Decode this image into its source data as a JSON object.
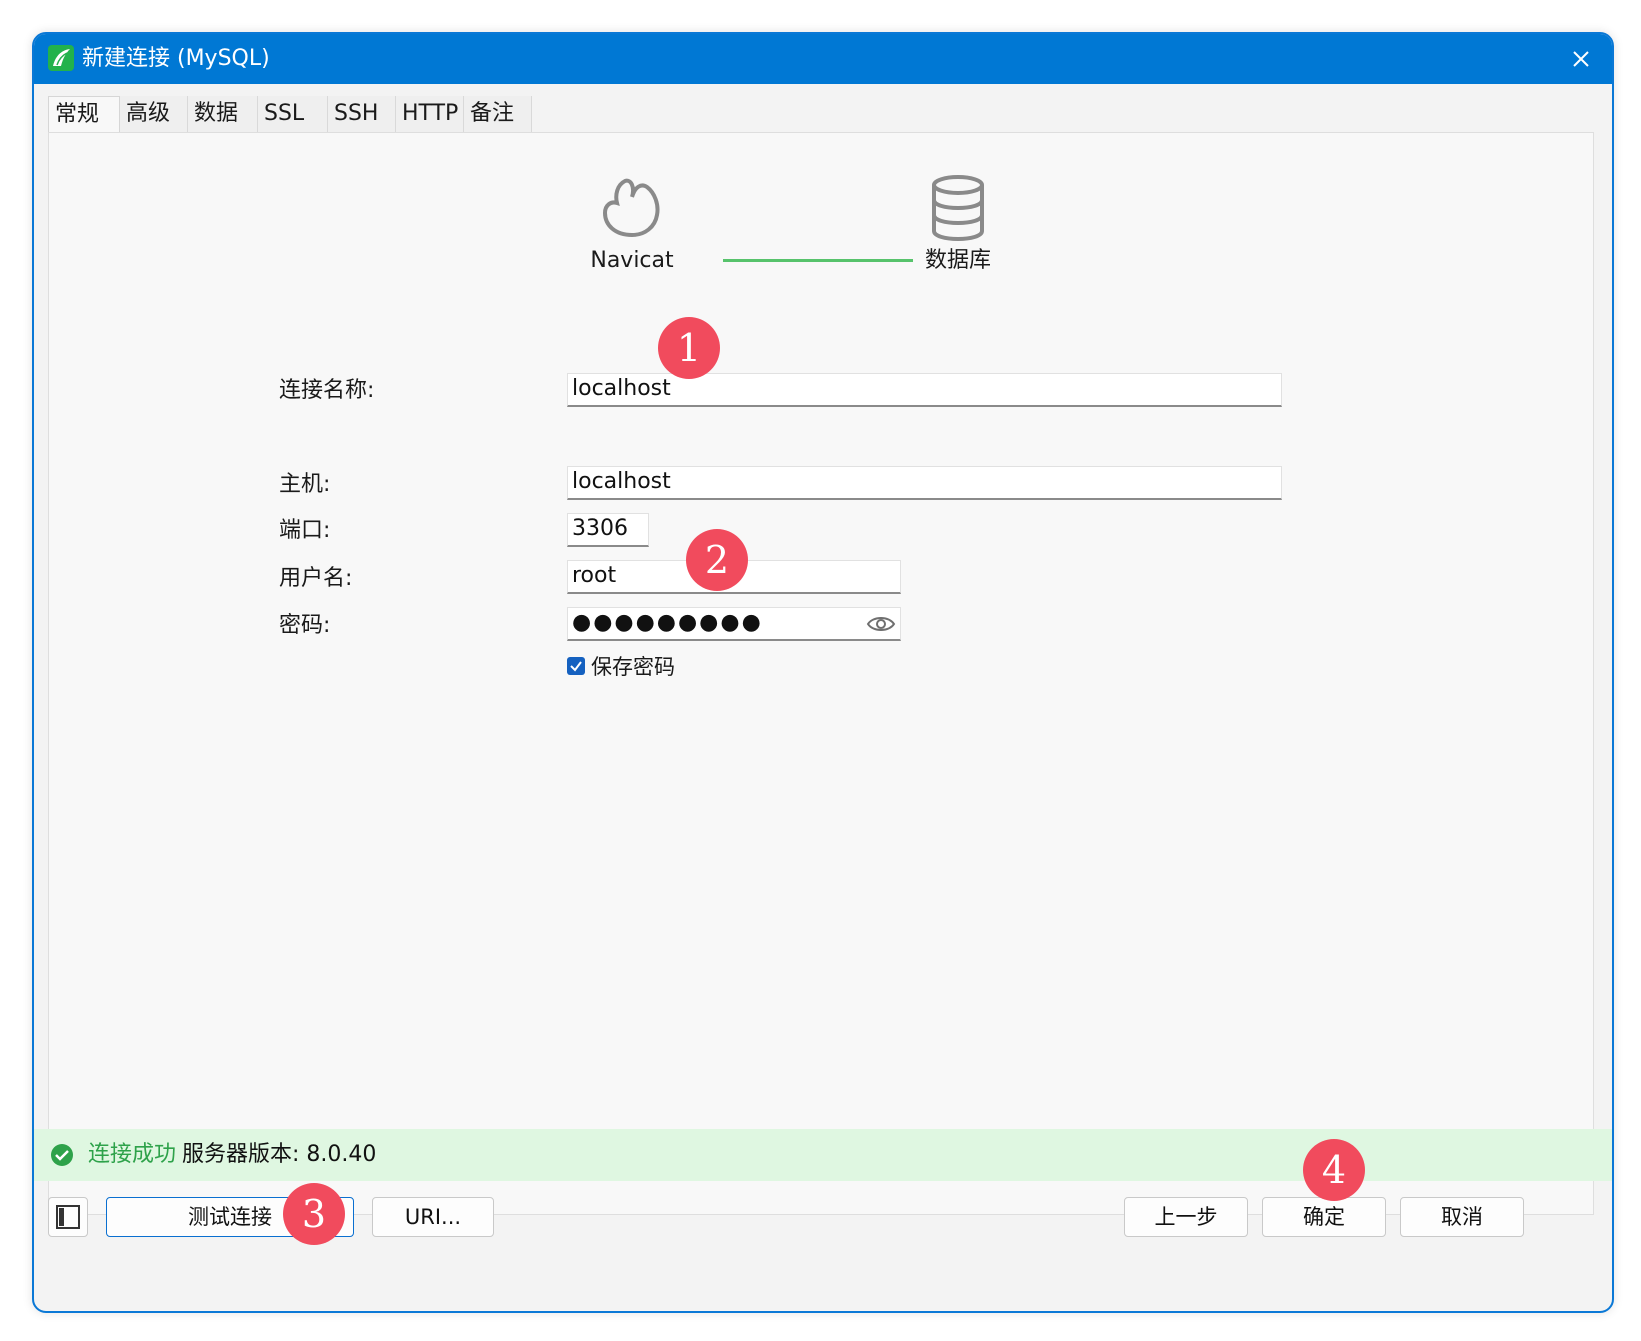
{
  "window": {
    "title": "新建连接 (MySQL)"
  },
  "tabs": [
    {
      "label": "常规",
      "active": true
    },
    {
      "label": "高级"
    },
    {
      "label": "数据库"
    },
    {
      "label": "SSL"
    },
    {
      "label": "SSH"
    },
    {
      "label": "HTTP"
    },
    {
      "label": "备注"
    }
  ],
  "diagram": {
    "left_label": "Navicat",
    "right_label": "数据库",
    "line_color": "#57c36c"
  },
  "form": {
    "connection_name": {
      "label": "连接名称:",
      "value": "localhost"
    },
    "host": {
      "label": "主机:",
      "value": "localhost"
    },
    "port": {
      "label": "端口:",
      "value": "3306"
    },
    "username": {
      "label": "用户名:",
      "value": "root"
    },
    "password": {
      "label": "密码:",
      "value": "●●●●●●●●●"
    },
    "save_password": {
      "label": "保存密码",
      "checked": true
    }
  },
  "status": {
    "ok_text": "连接成功",
    "version_text": "服务器版本: 8.0.40",
    "color": "#2ea24a"
  },
  "buttons": {
    "test": "测试连接",
    "uri": "URI...",
    "back": "上一步",
    "ok": "确定",
    "cancel": "取消"
  },
  "annotations": [
    "1",
    "2",
    "3",
    "4"
  ],
  "colors": {
    "titlebar": "#0078d4",
    "badge": "#f14b5d",
    "status_bg": "#dff7e1"
  }
}
